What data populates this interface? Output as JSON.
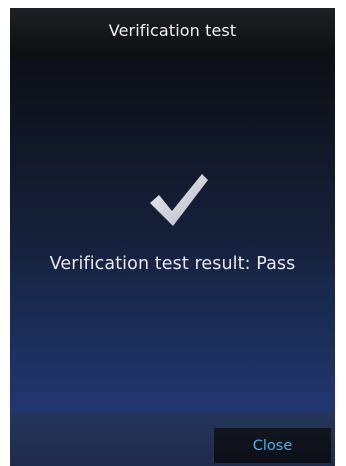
{
  "header": {
    "title": "Verification test"
  },
  "main": {
    "status_icon": "checkmark-icon",
    "result_text": "Verification test result: Pass"
  },
  "footer": {
    "close_label": "Close"
  },
  "colors": {
    "accent": "#49b3e6",
    "text": "#e8e8ea",
    "checkmark": "#d8d9de"
  }
}
